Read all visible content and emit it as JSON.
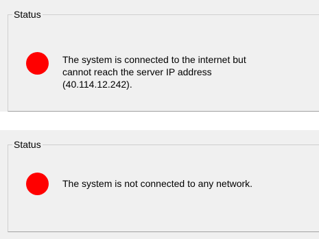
{
  "status_panels": [
    {
      "legend": "Status",
      "indicator_color": "#ff0000",
      "indicator": "red-status-circle",
      "message": "The system is connected to the internet but\ncannot reach the server IP address\n(40.114.12.242)."
    },
    {
      "legend": "Status",
      "indicator_color": "#ff0000",
      "indicator": "red-status-circle",
      "message": "The system is not connected to any network."
    }
  ]
}
